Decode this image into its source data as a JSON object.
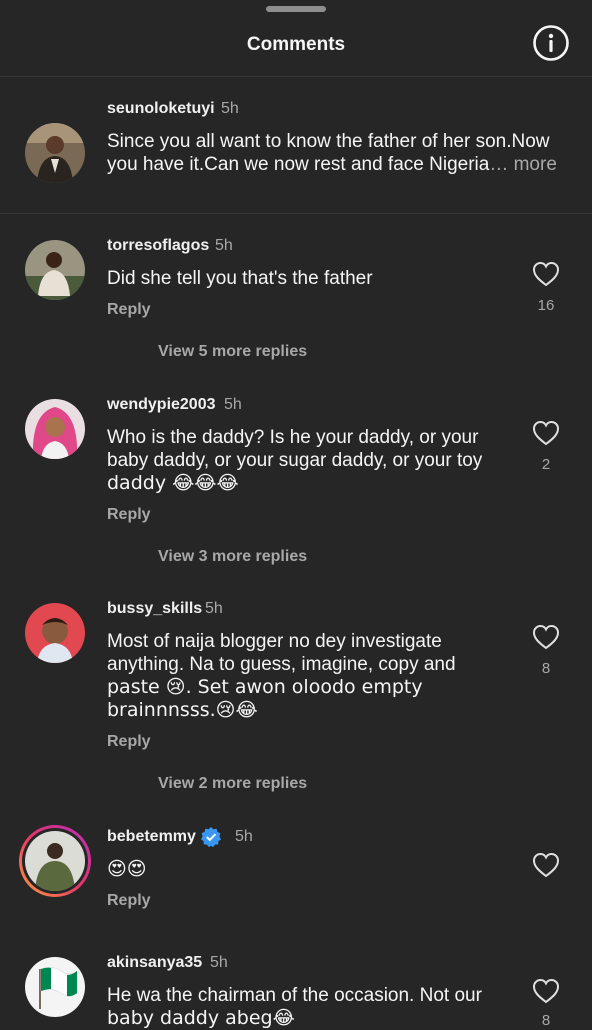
{
  "header": {
    "title": "Comments"
  },
  "caption": {
    "username": "seunoloketuyi",
    "time": "5h",
    "text": "Since you all want to know the father of her son.Now you have it.Can we now rest and face Nigeria",
    "more": "… more"
  },
  "comments": [
    {
      "username": "torresoflagos",
      "time": "5h",
      "text": "Did she tell you that's the father",
      "reply": "Reply",
      "likes": "16",
      "view_replies": "View 5 more replies"
    },
    {
      "username": "wendypie2003",
      "time": "5h",
      "text_lines": [
        "Who is the daddy? Is he your daddy, or your",
        "baby daddy, or your sugar daddy, or your toy",
        "daddy 😂😂😂"
      ],
      "reply": "Reply",
      "likes": "2",
      "view_replies": "View 3 more replies"
    },
    {
      "username": "bussy_skills",
      "time": "5h",
      "text_lines": [
        "Most of naija blogger no dey investigate",
        "anything. Na to guess, imagine, copy and",
        "paste 😢. Set awon oloodo empty",
        "brainnnsss.😢😂"
      ],
      "reply": "Reply",
      "likes": "8",
      "view_replies": "View 2 more replies"
    },
    {
      "username": "bebetemmy",
      "time": "5h",
      "text": "😍😍",
      "reply": "Reply",
      "verified": true
    },
    {
      "username": "akinsanya35",
      "time": "5h",
      "text_lines": [
        "He wa the chairman of the occasion. Not our",
        "baby daddy abeg😂"
      ],
      "likes": "8"
    }
  ],
  "colors": {
    "background": "#262626",
    "secondary_text": "#a8a8a8",
    "verified_blue": "#3897f0",
    "nigeria_green": "#008751"
  }
}
